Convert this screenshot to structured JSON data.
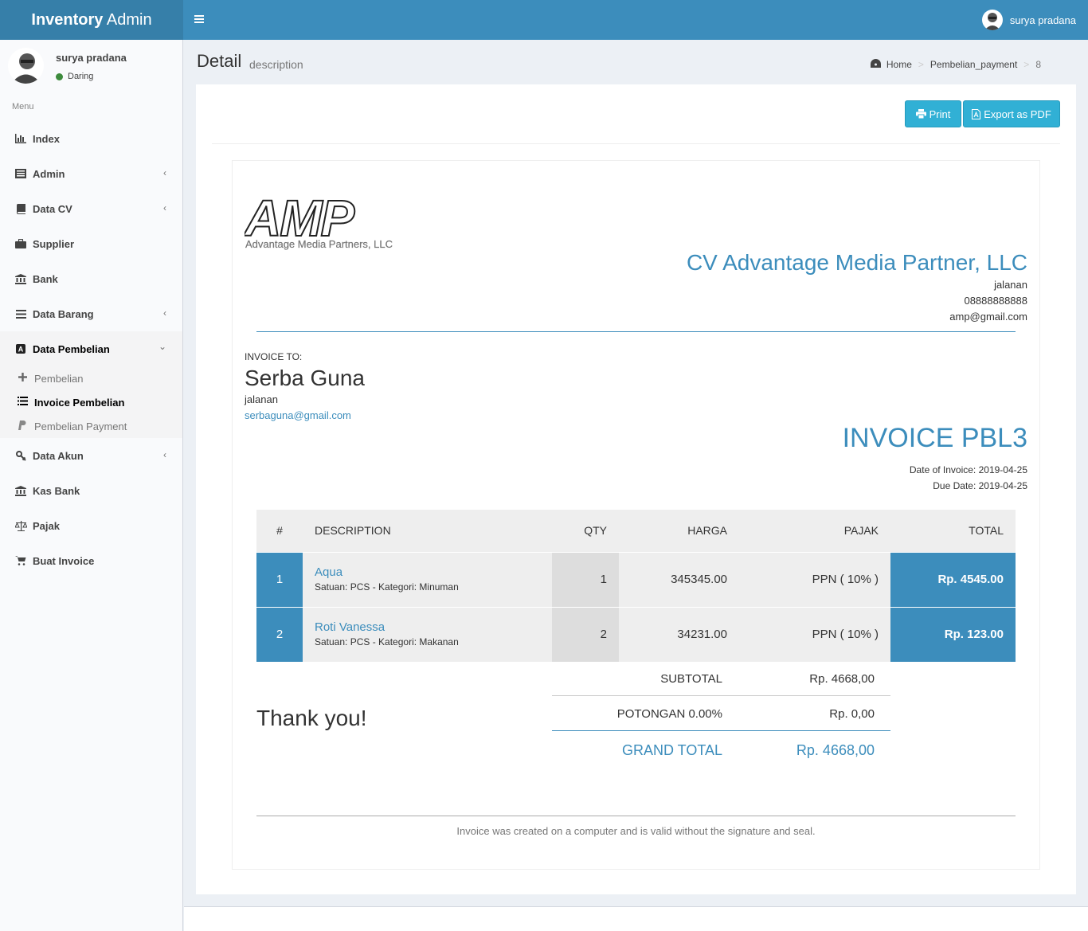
{
  "app": {
    "brand_bold": "Inventory",
    "brand_light": "Admin"
  },
  "user": {
    "name": "surya pradana",
    "status": "Daring"
  },
  "sidebar": {
    "menu_header": "Menu",
    "items": [
      {
        "label": "Index",
        "icon": "bar-chart-icon"
      },
      {
        "label": "Admin",
        "icon": "list-icon"
      },
      {
        "label": "Data CV",
        "icon": "book-icon"
      },
      {
        "label": "Supplier",
        "icon": "briefcase-icon"
      },
      {
        "label": "Bank",
        "icon": "bank-icon"
      },
      {
        "label": "Data Barang",
        "icon": "bars-icon"
      },
      {
        "label": "Data Pembelian",
        "icon": "amazon-icon"
      },
      {
        "label": "Data Akun",
        "icon": "key-icon"
      },
      {
        "label": "Kas Bank",
        "icon": "bank-icon"
      },
      {
        "label": "Pajak",
        "icon": "balance-scale-icon"
      },
      {
        "label": "Buat Invoice",
        "icon": "cart-icon"
      }
    ],
    "sub_items": [
      {
        "label": "Pembelian",
        "icon": "plus-icon"
      },
      {
        "label": "Invoice Pembelian",
        "icon": "list-icon"
      },
      {
        "label": "Pembelian Payment",
        "icon": "paypal-icon"
      }
    ]
  },
  "header": {
    "title": "Detail",
    "subtitle": "description"
  },
  "breadcrumb": {
    "home": "Home",
    "section": "Pembelian_payment",
    "current": "8"
  },
  "toolbar": {
    "print_label": "Print",
    "pdf_label": "Export as PDF"
  },
  "logo": {
    "mark": "AMP",
    "tagline": "Advantage Media Partners, LLC"
  },
  "company": {
    "name": "CV Advantage Media Partner, LLC",
    "address": "jalanan",
    "phone": "08888888888",
    "email": "amp@gmail.com"
  },
  "client": {
    "label": "INVOICE TO:",
    "name": "Serba Guna",
    "address": "jalanan",
    "email": "serbaguna@gmail.com"
  },
  "invoice": {
    "title": "INVOICE PBL3",
    "date": "Date of Invoice: 2019-04-25",
    "due": "Due Date: 2019-04-25"
  },
  "table": {
    "headers": {
      "no": "#",
      "desc": "DESCRIPTION",
      "qty": "QTY",
      "harga": "HARGA",
      "pajak": "PAJAK",
      "total": "TOTAL"
    },
    "rows": [
      {
        "no": "1",
        "name": "Aqua",
        "meta": "Satuan: PCS - Kategori: Minuman",
        "qty": "1",
        "harga": "345345.00",
        "pajak": "PPN ( 10% )",
        "total": "Rp. 4545.00"
      },
      {
        "no": "2",
        "name": "Roti Vanessa",
        "meta": "Satuan: PCS - Kategori: Makanan",
        "qty": "2",
        "harga": "34231.00",
        "pajak": "PPN ( 10% )",
        "total": "Rp. 123.00"
      }
    ]
  },
  "summary": {
    "thanks": "Thank you!",
    "subtotal_label": "SUBTOTAL",
    "subtotal_value": "Rp. 4668,00",
    "discount_label": "POTONGAN 0.00%",
    "discount_value": "Rp. 0,00",
    "grand_label": "GRAND TOTAL",
    "grand_value": "Rp. 4668,00"
  },
  "footer_note": "Invoice was created on a computer and is valid without the signature and seal.",
  "colors": {
    "primary": "#3c8dbc",
    "header_dark": "#367fa9",
    "info_button": "#31b0d5",
    "online": "#3d8b3d"
  }
}
